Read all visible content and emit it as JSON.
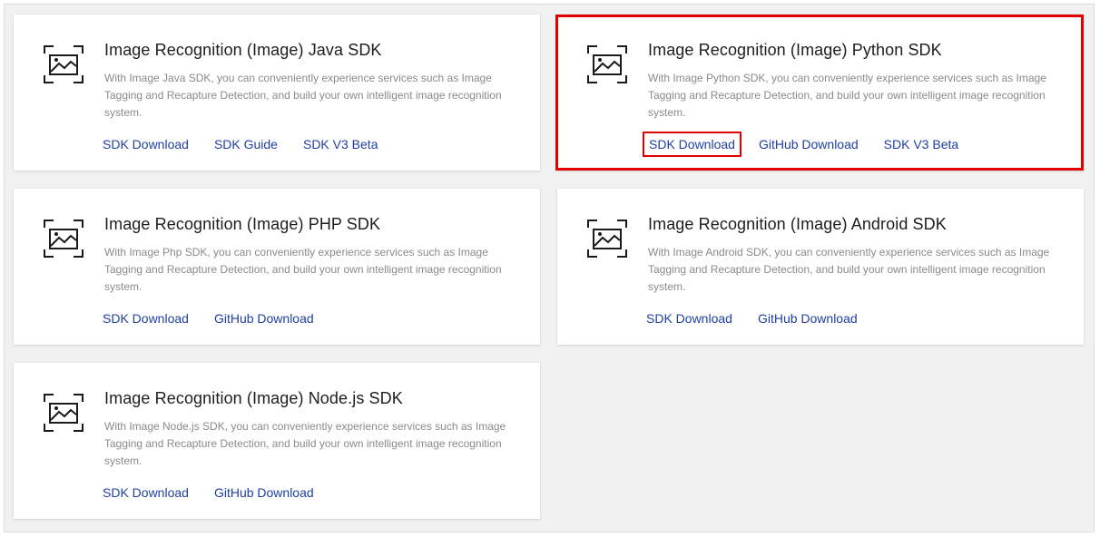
{
  "highlight_color": "#e00000",
  "link_color": "#1f3fa3",
  "cards": [
    {
      "title": "Image Recognition (Image) Java SDK",
      "description": "With Image Java SDK, you can conveniently experience services such as Image Tagging and Recapture Detection, and build your own intelligent image recognition system.",
      "links": [
        "SDK Download",
        "SDK Guide",
        "SDK V3 Beta"
      ]
    },
    {
      "title": "Image Recognition (Image) Python SDK",
      "description": "With Image Python SDK, you can conveniently experience services such as Image Tagging and Recapture Detection, and build your own intelligent image recognition system.",
      "links": [
        "SDK Download",
        "GitHub Download",
        "SDK V3 Beta"
      ],
      "highlighted": true
    },
    {
      "title": "Image Recognition (Image) PHP SDK",
      "description": "With Image Php SDK, you can conveniently experience services such as Image Tagging and Recapture Detection, and build your own intelligent image recognition system.",
      "links": [
        "SDK Download",
        "GitHub Download"
      ]
    },
    {
      "title": "Image Recognition (Image) Android SDK",
      "description": "With Image Android SDK, you can conveniently experience services such as Image Tagging and Recapture Detection, and build your own intelligent image recognition system.",
      "links": [
        "SDK Download",
        "GitHub Download"
      ]
    },
    {
      "title": "Image Recognition (Image) Node.js SDK",
      "description": "With Image Node.js SDK, you can conveniently experience services such as Image Tagging and Recapture Detection, and build your own intelligent image recognition system.",
      "links": [
        "SDK Download",
        "GitHub Download"
      ]
    }
  ]
}
